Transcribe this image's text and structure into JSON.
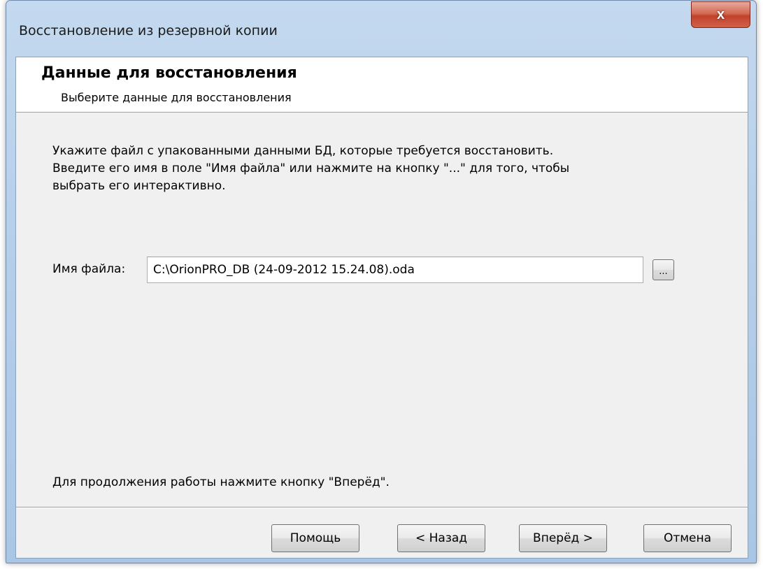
{
  "window": {
    "title": "Восстановление из резервной копии",
    "close_glyph": "x"
  },
  "header": {
    "title": "Данные для восстановления",
    "subtitle": "Выберите данные для восстановления"
  },
  "body": {
    "instructions": [
      "Укажите файл с упакованными данными БД, которые требуется восстановить.",
      "Введите его имя в поле \"Имя файла\" или нажмите на кнопку \"...\" для того, чтобы",
      "выбрать его интерактивно."
    ],
    "file_label": "Имя файла:",
    "file_value": "C:\\OrionPRO_DB (24-09-2012 15.24.08).oda",
    "browse_label": "...",
    "footer_hint": "Для продолжения работы нажмите кнопку \"Вперёд\"."
  },
  "buttons": {
    "help": "Помощь",
    "back": "< Назад",
    "next": "Вперёд >",
    "cancel": "Отмена"
  }
}
